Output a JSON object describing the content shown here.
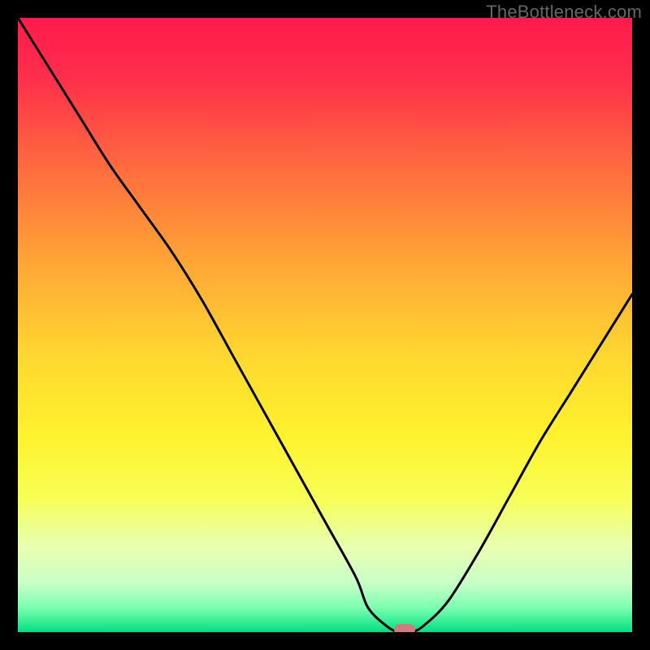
{
  "watermark": "TheBottleneck.com",
  "colors": {
    "frame": "#000000",
    "curve": "#000000",
    "marker": "#d77a7f",
    "gradient_stops": [
      {
        "offset": 0.0,
        "color": "#ff1a4d"
      },
      {
        "offset": 0.1,
        "color": "#ff2f4a"
      },
      {
        "offset": 0.25,
        "color": "#ff6e3e"
      },
      {
        "offset": 0.4,
        "color": "#ffa636"
      },
      {
        "offset": 0.55,
        "color": "#ffd72f"
      },
      {
        "offset": 0.68,
        "color": "#fff22e"
      },
      {
        "offset": 0.78,
        "color": "#f7ff55"
      },
      {
        "offset": 0.86,
        "color": "#eaffb0"
      },
      {
        "offset": 0.92,
        "color": "#c8ffc8"
      },
      {
        "offset": 0.96,
        "color": "#7bffb0"
      },
      {
        "offset": 1.0,
        "color": "#00e083"
      }
    ]
  },
  "chart_data": {
    "type": "line",
    "title": "",
    "xlabel": "",
    "ylabel": "",
    "xlim": [
      0,
      100
    ],
    "ylim": [
      0,
      100
    ],
    "x": [
      0,
      5,
      10,
      15,
      20,
      25,
      30,
      35,
      40,
      45,
      50,
      55,
      57,
      60,
      62,
      64,
      66,
      70,
      75,
      80,
      85,
      90,
      95,
      100
    ],
    "values": [
      100,
      92,
      84,
      76,
      69,
      62,
      54,
      45,
      36,
      27,
      18,
      9,
      4,
      1,
      0,
      0,
      1,
      5,
      13,
      22,
      31,
      39,
      47,
      55
    ],
    "marker": {
      "x": 63,
      "y": 0
    },
    "annotations": []
  }
}
